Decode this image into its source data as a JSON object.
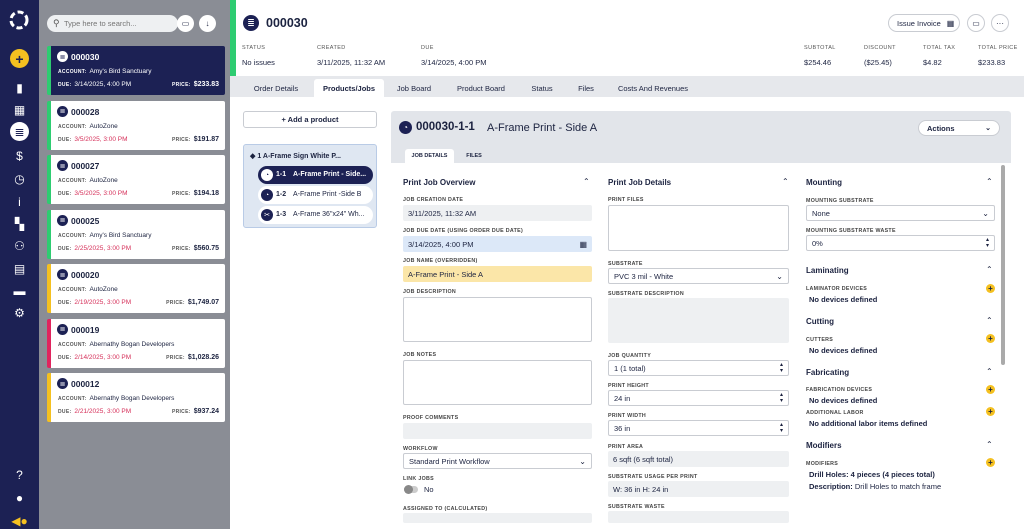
{
  "search": {
    "placeholder": "Type here to search..."
  },
  "orders": [
    {
      "number": "000030",
      "account": "Amy's Bird Sanctuary",
      "due": "3/14/2025, 4:00 PM",
      "price": "$233.83",
      "color": "#2ecc71",
      "active": true
    },
    {
      "number": "000028",
      "account": "AutoZone",
      "due": "3/5/2025, 3:00 PM",
      "price": "$191.87",
      "color": "#2ecc71"
    },
    {
      "number": "000027",
      "account": "AutoZone",
      "due": "3/5/2025, 3:00 PM",
      "price": "$194.18",
      "color": "#2ecc71"
    },
    {
      "number": "000025",
      "account": "Amy's Bird Sanctuary",
      "due": "2/25/2025, 3:00 PM",
      "price": "$560.75",
      "color": "#2ecc71"
    },
    {
      "number": "000020",
      "account": "AutoZone",
      "due": "2/19/2025, 3:00 PM",
      "price": "$1,749.07",
      "color": "#f4c020"
    },
    {
      "number": "000019",
      "account": "Abernathy Bogan Developers",
      "due": "2/14/2025, 3:00 PM",
      "price": "$1,028.26",
      "color": "#e0245e"
    },
    {
      "number": "000012",
      "account": "Abernathy Bogan Developers",
      "due": "2/21/2025, 3:00 PM",
      "price": "$937.24",
      "color": "#f4c020"
    }
  ],
  "order_labels": {
    "account": "ACCOUNT:",
    "due": "DUE:",
    "price": "PRICE:"
  },
  "header": {
    "order_number": "000030",
    "issue_invoice": "Issue Invoice",
    "status_label": "STATUS",
    "status": "No issues",
    "created_label": "CREATED",
    "created": "3/11/2025, 11:32 AM",
    "due_label": "DUE",
    "due": "3/14/2025, 4:00 PM",
    "subtotal_label": "SUBTOTAL",
    "subtotal": "$254.46",
    "discount_label": "DISCOUNT",
    "discount": "($25.45)",
    "tax_label": "TOTAL TAX",
    "tax": "$4.82",
    "total_label": "TOTAL PRICE",
    "total": "$233.83"
  },
  "tabs": [
    "Order Details",
    "Products/Jobs",
    "Job Board",
    "Product Board",
    "Status",
    "Files",
    "Costs And Revenues"
  ],
  "products": {
    "add_button": "+ Add a product",
    "group": "1 A-Frame Sign White P...",
    "items": [
      {
        "code": "1-1",
        "name": "A-Frame Print - Side..."
      },
      {
        "code": "1-2",
        "name": "A-Frame Print -Side B"
      },
      {
        "code": "1-3",
        "name": "A-Frame 36\"x24\" Wh..."
      }
    ]
  },
  "job": {
    "code": "000030-1-1",
    "name": "A-Frame Print - Side A",
    "actions": "Actions",
    "subtabs": [
      "JOB DETAILS",
      "FILES"
    ],
    "overview": {
      "title": "Print Job Overview",
      "creation_label": "JOB CREATION DATE",
      "creation": "3/11/2025, 11:32 AM",
      "due_label": "JOB DUE DATE (USING ORDER DUE DATE)",
      "due": "3/14/2025, 4:00 PM",
      "name_label": "JOB NAME (OVERRIDDEN)",
      "name": "A-Frame Print - Side A",
      "desc_label": "JOB DESCRIPTION",
      "notes_label": "JOB NOTES",
      "proof_label": "PROOF COMMENTS",
      "workflow_label": "WORKFLOW",
      "workflow": "Standard Print Workflow",
      "link_label": "LINK JOBS",
      "link": "No",
      "assigned_label": "ASSIGNED TO (CALCULATED)"
    },
    "details": {
      "title": "Print Job Details",
      "files_label": "PRINT FILES",
      "substrate_label": "SUBSTRATE",
      "substrate": "PVC 3 mil - White",
      "subdesc_label": "SUBSTRATE DESCRIPTION",
      "qty_label": "JOB QUANTITY",
      "qty": "1  (1 total)",
      "height_label": "PRINT HEIGHT",
      "height": "24 in",
      "width_label": "PRINT WIDTH",
      "width": "36 in",
      "area_label": "PRINT AREA",
      "area": "6 sqft (6 sqft total)",
      "usage_label": "SUBSTRATE USAGE PER PRINT",
      "usage": "W: 36 in H: 24 in",
      "waste_label": "SUBSTRATE WASTE"
    },
    "mounting": {
      "title": "Mounting",
      "substrate_label": "MOUNTING SUBSTRATE",
      "substrate": "None",
      "waste_label": "MOUNTING SUBSTRATE WASTE",
      "waste": "0%"
    },
    "laminating": {
      "title": "Laminating",
      "label": "LAMINATOR DEVICES",
      "value": "No devices defined"
    },
    "cutting": {
      "title": "Cutting",
      "label": "CUTTERS",
      "value": "No devices defined"
    },
    "fabricating": {
      "title": "Fabricating",
      "label": "FABRICATION DEVICES",
      "value": "No devices defined",
      "labor_label": "ADDITIONAL LABOR",
      "labor": "No additional labor items defined"
    },
    "modifiers": {
      "title": "Modifiers",
      "label": "MODIFIERS",
      "value": "Drill Holes: 4 pieces (4 pieces total)",
      "desc_label": "Description:",
      "desc": "Drill Holes to match frame"
    }
  }
}
